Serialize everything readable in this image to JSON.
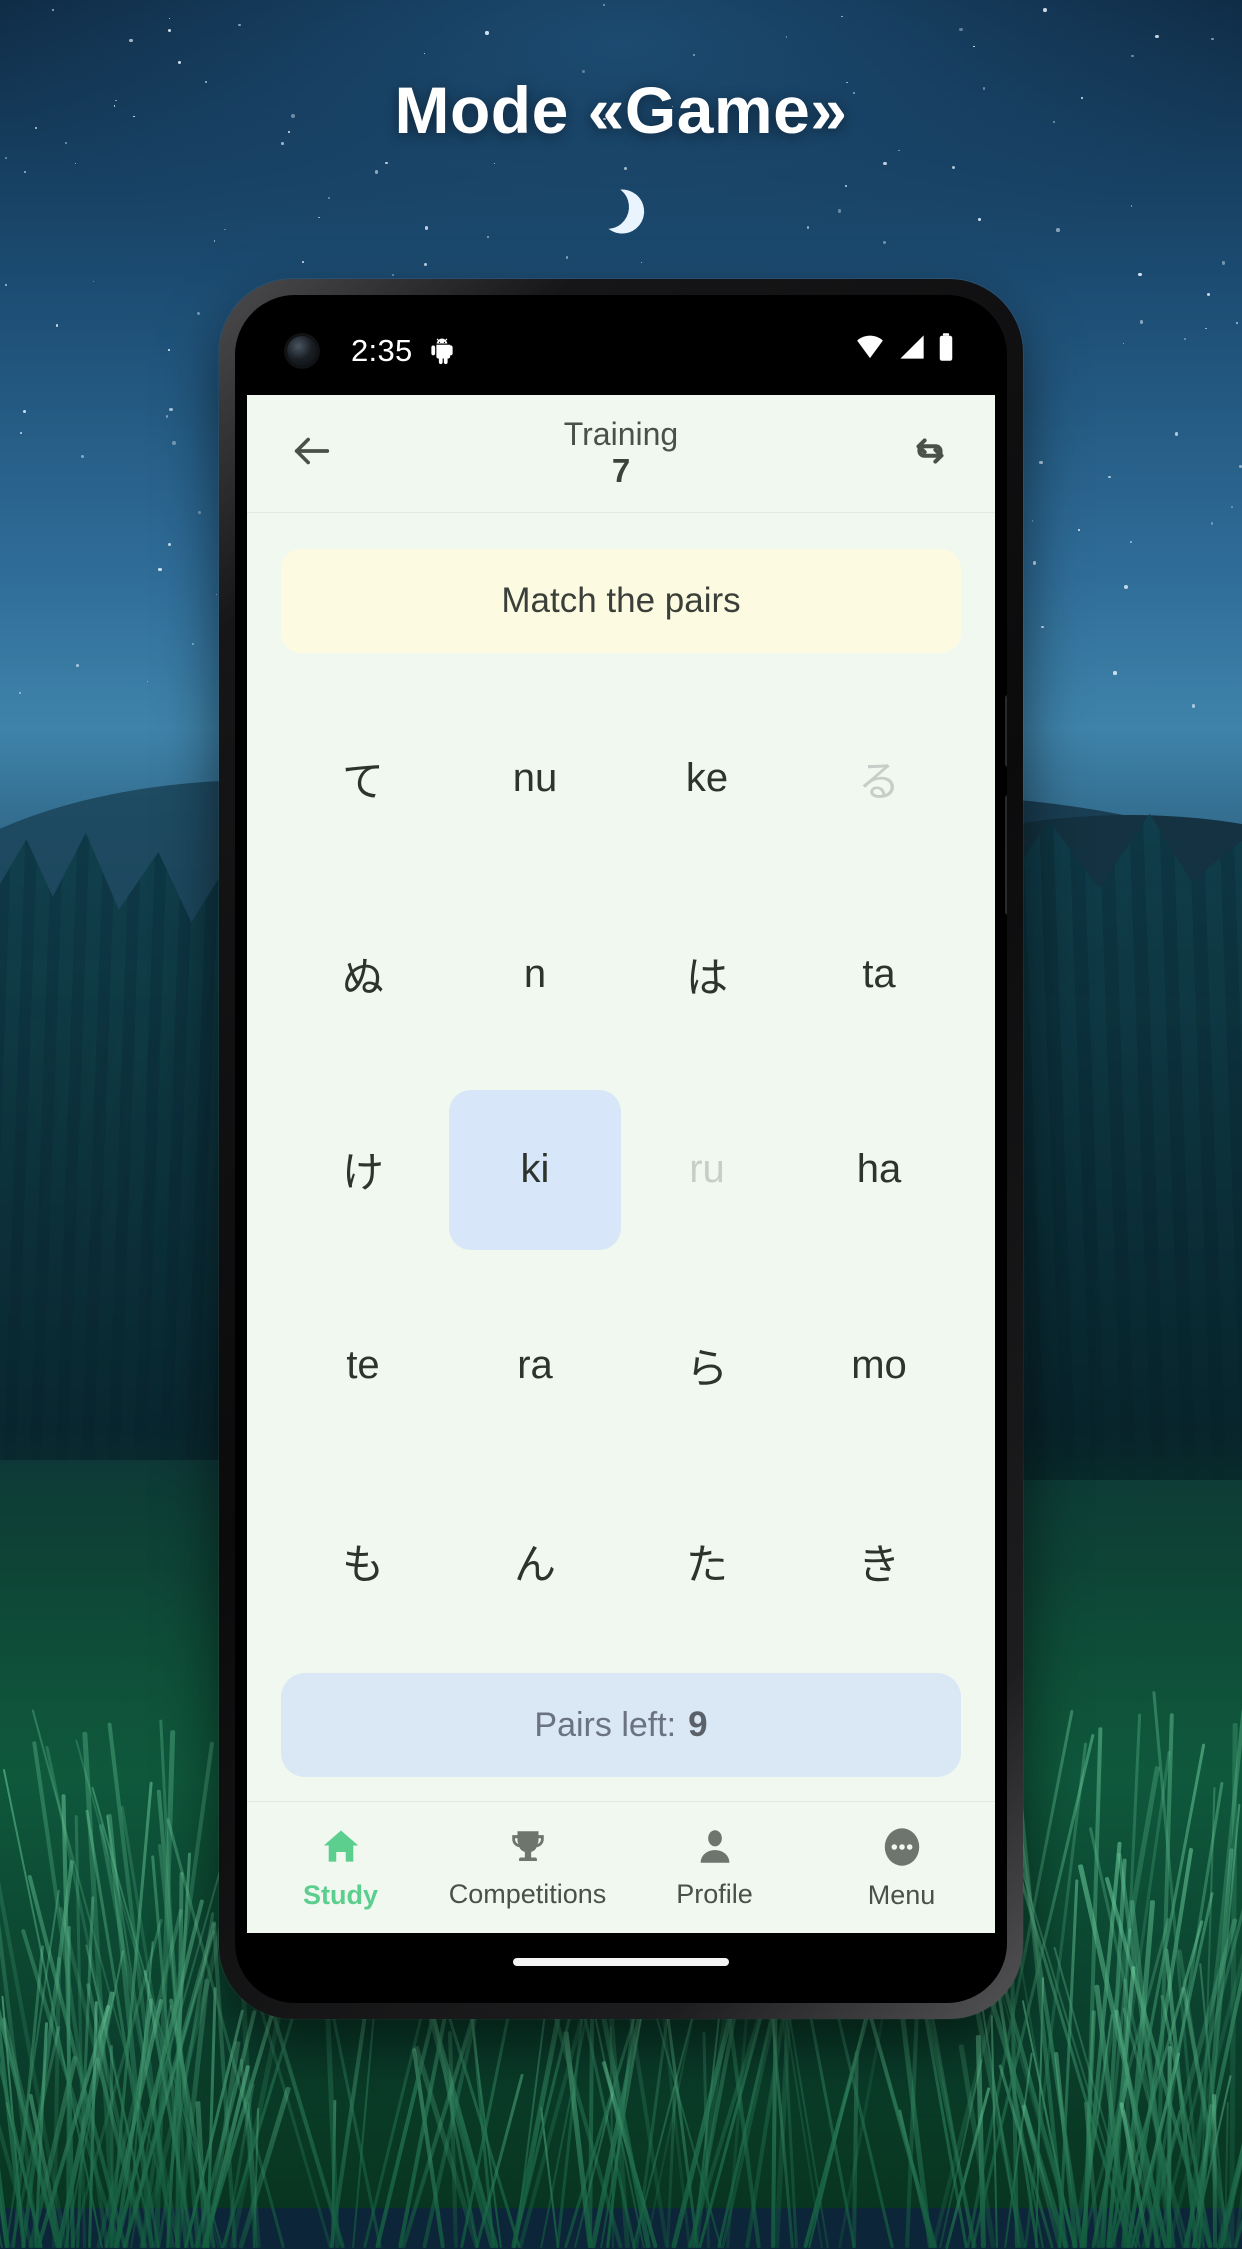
{
  "poster": {
    "title": "Mode «Game»"
  },
  "status_bar": {
    "time": "2:35",
    "icons": [
      "android-bug-icon",
      "wifi-icon",
      "cellular-signal-icon",
      "battery-icon"
    ]
  },
  "app_bar": {
    "back_icon": "back-arrow-icon",
    "title": "Training",
    "subtitle": "7",
    "refresh_icon": "refresh-icon"
  },
  "banner": {
    "text": "Match the pairs"
  },
  "board": {
    "rows": [
      [
        {
          "label": "て",
          "kind": "kana",
          "state": "normal"
        },
        {
          "label": "nu",
          "kind": "romaji",
          "state": "normal"
        },
        {
          "label": "ke",
          "kind": "romaji",
          "state": "normal"
        },
        {
          "label": "る",
          "kind": "kana",
          "state": "matched"
        }
      ],
      [
        {
          "label": "ぬ",
          "kind": "kana",
          "state": "normal"
        },
        {
          "label": "n",
          "kind": "romaji",
          "state": "normal"
        },
        {
          "label": "は",
          "kind": "kana",
          "state": "normal"
        },
        {
          "label": "ta",
          "kind": "romaji",
          "state": "normal"
        }
      ],
      [
        {
          "label": "け",
          "kind": "kana",
          "state": "normal"
        },
        {
          "label": "ki",
          "kind": "romaji",
          "state": "selected"
        },
        {
          "label": "ru",
          "kind": "romaji",
          "state": "matched"
        },
        {
          "label": "ha",
          "kind": "romaji",
          "state": "normal"
        }
      ],
      [
        {
          "label": "te",
          "kind": "romaji",
          "state": "normal"
        },
        {
          "label": "ra",
          "kind": "romaji",
          "state": "normal"
        },
        {
          "label": "ら",
          "kind": "kana",
          "state": "normal"
        },
        {
          "label": "mo",
          "kind": "romaji",
          "state": "normal"
        }
      ],
      [
        {
          "label": "も",
          "kind": "kana",
          "state": "normal"
        },
        {
          "label": "ん",
          "kind": "kana",
          "state": "normal"
        },
        {
          "label": "た",
          "kind": "kana",
          "state": "normal"
        },
        {
          "label": "き",
          "kind": "kana",
          "state": "normal"
        }
      ]
    ]
  },
  "pairs_left": {
    "label": "Pairs left:",
    "count": "9"
  },
  "bottom_nav": {
    "items": [
      {
        "label": "Study",
        "icon": "home-icon",
        "active": true
      },
      {
        "label": "Competitions",
        "icon": "trophy-icon",
        "active": false
      },
      {
        "label": "Profile",
        "icon": "person-icon",
        "active": false
      },
      {
        "label": "Menu",
        "icon": "more-dots-icon",
        "active": false
      }
    ]
  },
  "colors": {
    "app_background": "#f1f8ef",
    "banner": "#fcfbe1",
    "selected_tile": "#d7e6f8",
    "pairs_pill": "#d9e8f4",
    "accent_green": "#5ccf8f",
    "muted_text": "#c9cdc9"
  }
}
